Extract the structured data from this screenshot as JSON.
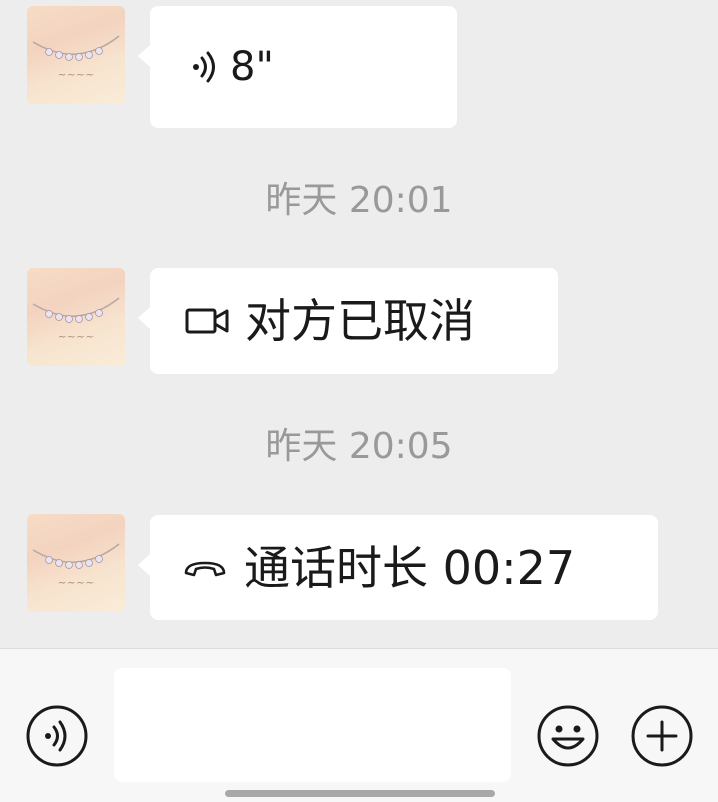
{
  "messages": [
    {
      "type": "voice",
      "icon": "voice-wave-icon",
      "text": "8\""
    },
    {
      "type": "timestamp",
      "text": "昨天 20:01"
    },
    {
      "type": "video-call",
      "icon": "video-camera-icon",
      "text": "对方已取消"
    },
    {
      "type": "timestamp",
      "text": "昨天 20:05"
    },
    {
      "type": "voice-call",
      "icon": "phone-hangup-icon",
      "text": "通话时长 00:27"
    }
  ],
  "input_bar": {
    "voice_icon": "voice-input-icon",
    "placeholder": "",
    "value": "",
    "emoji_icon": "emoji-smile-icon",
    "more_icon": "plus-icon"
  },
  "colors": {
    "background": "#ededed",
    "bubble": "#ffffff",
    "timestamp": "#999999",
    "text": "#1a1a1a",
    "input_bar": "#f7f7f7"
  }
}
